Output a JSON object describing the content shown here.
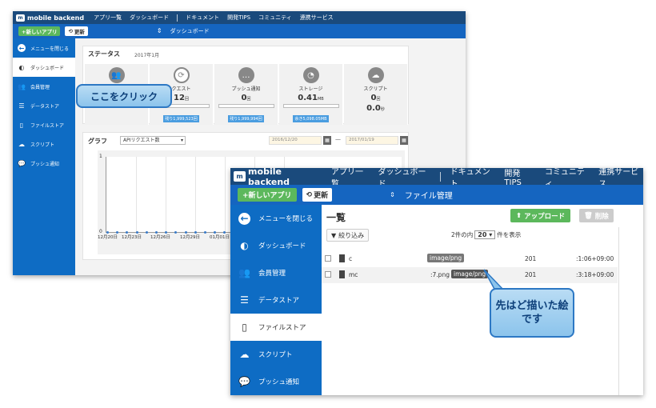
{
  "back_window": {
    "logo": {
      "badge": "m",
      "text": "mobile backend"
    },
    "nav": [
      "アプリ一覧",
      "ダッシュボード",
      "ドキュメント",
      "開発TIPS",
      "コミュニティ",
      "連携サービス"
    ],
    "new_app": "+新しいアプリ",
    "refresh": "更新",
    "breadcrumb": "ダッシュボード",
    "sidebar": [
      {
        "label": "メニューを閉じる",
        "icon": "arrow-left-icon"
      },
      {
        "label": "ダッシュボード",
        "icon": "dashboard-icon",
        "active": true
      },
      {
        "label": "会員管理",
        "icon": "users-icon"
      },
      {
        "label": "データストア",
        "icon": "list-icon"
      },
      {
        "label": "ファイルストア",
        "icon": "file-icon"
      },
      {
        "label": "スクリプト",
        "icon": "cloud-gear-icon"
      },
      {
        "label": "プッシュ通知",
        "icon": "chat-bubble-icon"
      }
    ],
    "status": {
      "title": "ステータス",
      "month": "2017年1月",
      "cards": [
        {
          "label": "",
          "value": "",
          "icon": "users-icon"
        },
        {
          "label": "クエスト",
          "value": "12",
          "unit": "回",
          "remaining": "残り1,999,523回"
        },
        {
          "label": "プッシュ通知",
          "value": "0",
          "unit": "回",
          "remaining": "残り1,999,994回"
        },
        {
          "label": "ストレージ",
          "value": "0.41",
          "unit": "MB",
          "remaining": "余き5,098.05MB"
        },
        {
          "label": "スクリプト",
          "value": "0",
          "unit": "回",
          "value2": "0.0",
          "unit2": "秒"
        }
      ]
    },
    "graph": {
      "title": "グラフ",
      "select": "APIリクエスト数",
      "date_from": "2016/12/20",
      "date_to": "2017/01/19",
      "dash": "—"
    },
    "chart_data": {
      "type": "line",
      "title": "",
      "yticks": [
        "1",
        "0"
      ],
      "xticks": [
        "12月20日",
        "12月23日",
        "12月26日",
        "12月29日",
        "01月01日"
      ],
      "ylim": [
        0,
        1
      ]
    },
    "callout": "ここをクリック"
  },
  "front_window": {
    "logo": {
      "badge": "m",
      "text": "mobile backend"
    },
    "nav": [
      "アプリ一覧",
      "ダッシュボード",
      "ドキュメント",
      "開発TIPS",
      "コミュニティ",
      "連携サービス"
    ],
    "new_app": "+新しいアプリ",
    "refresh": "更新",
    "breadcrumb": "ファイル管理",
    "sidebar": [
      {
        "label": "メニューを閉じる",
        "icon": "arrow-left-icon"
      },
      {
        "label": "ダッシュボード",
        "icon": "dashboard-icon"
      },
      {
        "label": "会員管理",
        "icon": "users-icon"
      },
      {
        "label": "データストア",
        "icon": "list-icon"
      },
      {
        "label": "ファイルストア",
        "icon": "file-icon",
        "active": true
      },
      {
        "label": "スクリプト",
        "icon": "cloud-gear-icon"
      },
      {
        "label": "プッシュ通知",
        "icon": "chat-bubble-icon"
      }
    ],
    "list_title": "一覧",
    "upload": "アップロード",
    "delete": "削除",
    "filter": "絞り込み",
    "pager": {
      "prefix": "2件の内",
      "count": "20",
      "suffix": "件を表示"
    },
    "files": [
      {
        "name": "c",
        "type": "image/png",
        "acl": "201",
        "updated": ":1:06+09:00"
      },
      {
        "name": "mc",
        "ext": ":7.png",
        "type": "image/png",
        "acl": "201",
        "updated": "​:3:18+09:00"
      }
    ],
    "callout": "先はど描いた絵です"
  }
}
